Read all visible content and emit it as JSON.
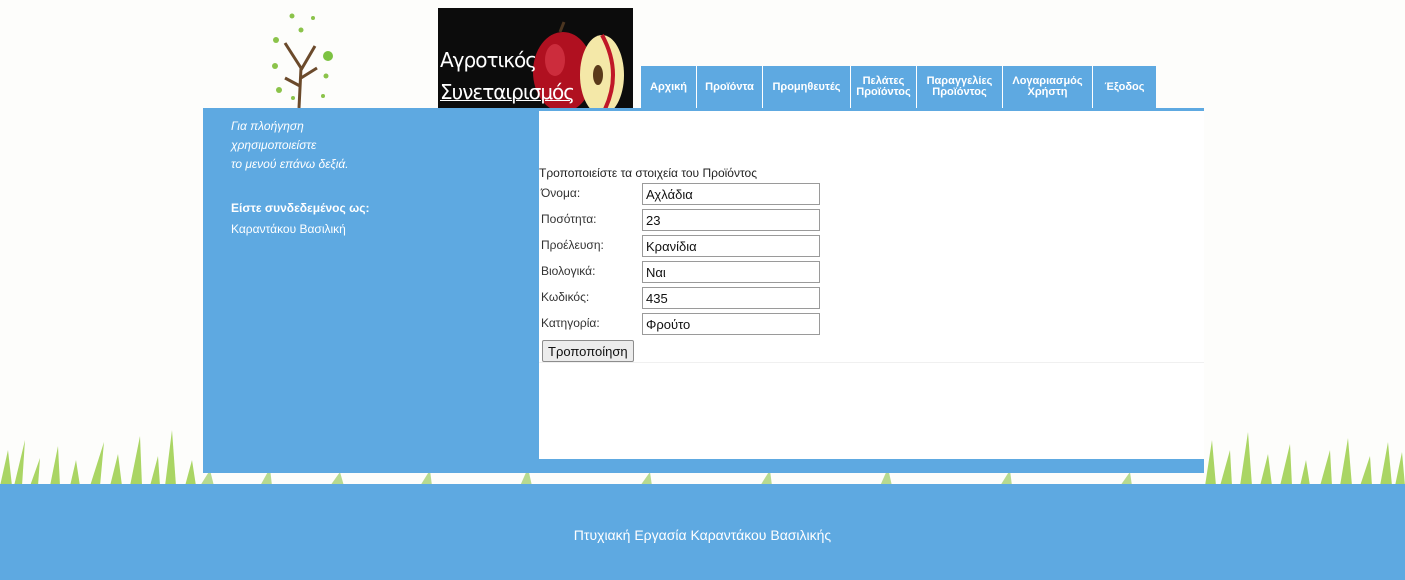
{
  "header": {
    "banner_line1": "Αγροτικός",
    "banner_line2": "Συνεταιρισμός"
  },
  "nav": [
    {
      "label": "Αρχική"
    },
    {
      "label": "Προϊόντα"
    },
    {
      "label": "Προμηθευτές"
    },
    {
      "label": "Πελάτες\nΠροϊόντος"
    },
    {
      "label": "Παραγγελίες\nΠροϊόντος"
    },
    {
      "label": "Λογαριασμός\nΧρήστη"
    },
    {
      "label": "Έξοδος"
    }
  ],
  "sidebar": {
    "hint_lines": [
      "Για πλοήγηση",
      "χρησιμοποιείστε",
      "το μενού επάνω δεξιά."
    ],
    "logged_in_label": "Είστε συνδεδεμένος ως:",
    "user_name": "Καραντάκου Βασιλική"
  },
  "form": {
    "title": "Τροποποιείστε τα στοιχεία του Προϊόντος",
    "fields": [
      {
        "label": "Όνομα:",
        "value": "Αχλάδια"
      },
      {
        "label": "Ποσότητα:",
        "value": "23"
      },
      {
        "label": "Προέλευση:",
        "value": "Κρανίδια"
      },
      {
        "label": "Βιολογικά:",
        "value": "Ναι"
      },
      {
        "label": "Κωδικός:",
        "value": "435"
      },
      {
        "label": "Κατηγορία:",
        "value": "Φρούτο"
      }
    ],
    "submit_label": "Τροποποίηση"
  },
  "footer": {
    "text": "Πτυχιακή Εργασία Καραντάκου Βασιλικής"
  },
  "colors": {
    "accent": "#5ea9e1",
    "background": "#fdfdfb"
  }
}
